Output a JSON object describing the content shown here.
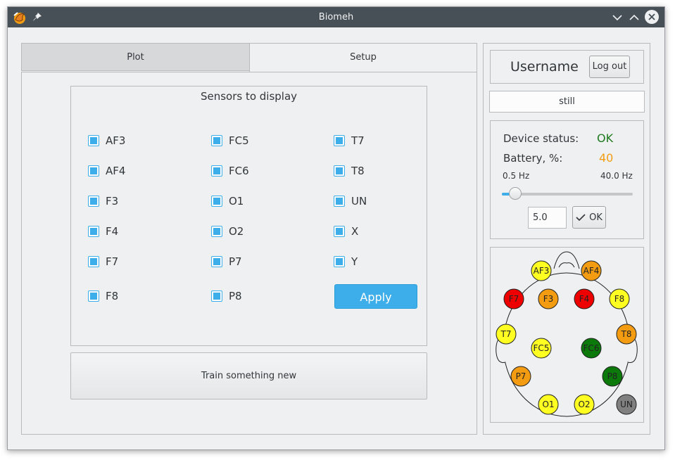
{
  "window": {
    "title": "Biomeh"
  },
  "tabs": [
    {
      "label": "Plot",
      "active": true
    },
    {
      "label": "Setup",
      "active": false
    }
  ],
  "sensors_group": {
    "title": "Sensors to display",
    "columns": [
      [
        "AF3",
        "AF4",
        "F3",
        "F4",
        "F7",
        "F8"
      ],
      [
        "FC5",
        "FC6",
        "O1",
        "O2",
        "P7",
        "P8"
      ],
      [
        "T7",
        "T8",
        "UN",
        "X",
        "Y"
      ]
    ],
    "all_checked": true,
    "apply_label": "Apply"
  },
  "train_button": "Train something new",
  "user": {
    "name": "Username",
    "logout_label": "Log out"
  },
  "state_text": "still",
  "device": {
    "status_label": "Device status:",
    "status_value": "OK",
    "battery_label": "Battery, %:",
    "battery_value": "40",
    "freq_min_label": "0.5 Hz",
    "freq_max_label": "40.0 Hz",
    "slider_fraction": 0.1,
    "freq_input_value": "5.0",
    "ok_label": "OK"
  },
  "colors": {
    "accent": "#3daee9",
    "status_ok": "#1e7a1e",
    "battery": "#f39c12",
    "sensor_red": "#ee0000",
    "sensor_orange": "#f39c12",
    "sensor_yellow": "#ffff22",
    "sensor_green": "#0b7a0b",
    "sensor_gray": "#808080"
  },
  "head_sensors": [
    {
      "name": "AF3",
      "color": "yellow"
    },
    {
      "name": "AF4",
      "color": "orange"
    },
    {
      "name": "F7",
      "color": "red"
    },
    {
      "name": "F3",
      "color": "orange"
    },
    {
      "name": "F4",
      "color": "red"
    },
    {
      "name": "F8",
      "color": "yellow"
    },
    {
      "name": "T7",
      "color": "yellow"
    },
    {
      "name": "T8",
      "color": "orange"
    },
    {
      "name": "FC5",
      "color": "yellow"
    },
    {
      "name": "FC6",
      "color": "green"
    },
    {
      "name": "P7",
      "color": "orange"
    },
    {
      "name": "P8",
      "color": "green"
    },
    {
      "name": "O1",
      "color": "yellow"
    },
    {
      "name": "O2",
      "color": "yellow"
    },
    {
      "name": "UN",
      "color": "gray"
    }
  ]
}
